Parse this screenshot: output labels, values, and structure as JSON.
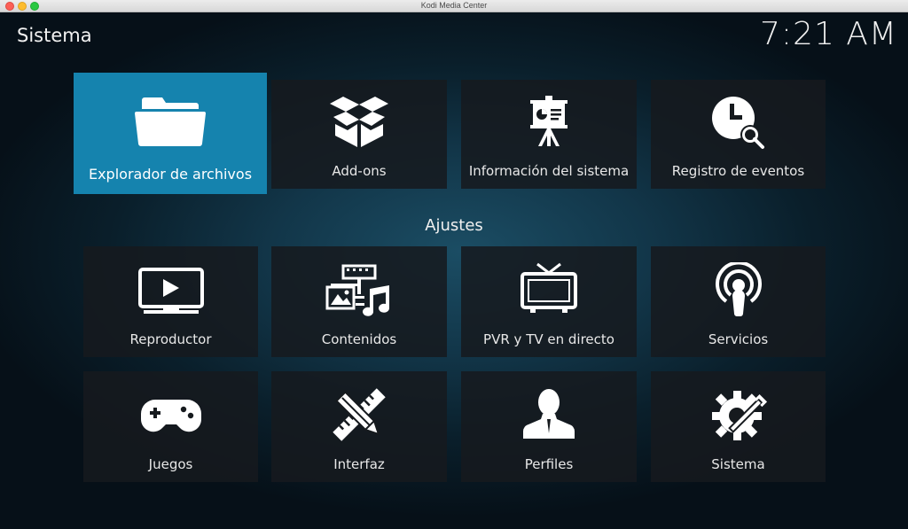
{
  "window": {
    "title": "Kodi Media Center"
  },
  "header": {
    "title": "Sistema",
    "clock": "7:21 AM"
  },
  "top_row": [
    {
      "label": "Explorador de archivos",
      "icon": "folder-icon",
      "focused": true
    },
    {
      "label": "Add-ons",
      "icon": "open-box-icon"
    },
    {
      "label": "Información del sistema",
      "icon": "presentation-board-icon"
    },
    {
      "label": "Registro de eventos",
      "icon": "clock-search-icon"
    }
  ],
  "section": {
    "title": "Ajustes"
  },
  "settings": [
    {
      "label": "Reproductor",
      "icon": "play-screen-icon"
    },
    {
      "label": "Contenidos",
      "icon": "media-library-icon"
    },
    {
      "label": "PVR y TV en directo",
      "icon": "tv-antenna-icon"
    },
    {
      "label": "Servicios",
      "icon": "podcast-icon"
    },
    {
      "label": "Juegos",
      "icon": "gamepad-icon"
    },
    {
      "label": "Interfaz",
      "icon": "pencil-ruler-icon"
    },
    {
      "label": "Perfiles",
      "icon": "user-silhouette-icon"
    },
    {
      "label": "Sistema",
      "icon": "gear-wrench-icon"
    }
  ],
  "colors": {
    "focus": "#1583ae",
    "tile": "#161a1e",
    "text": "#e8e8e8"
  }
}
